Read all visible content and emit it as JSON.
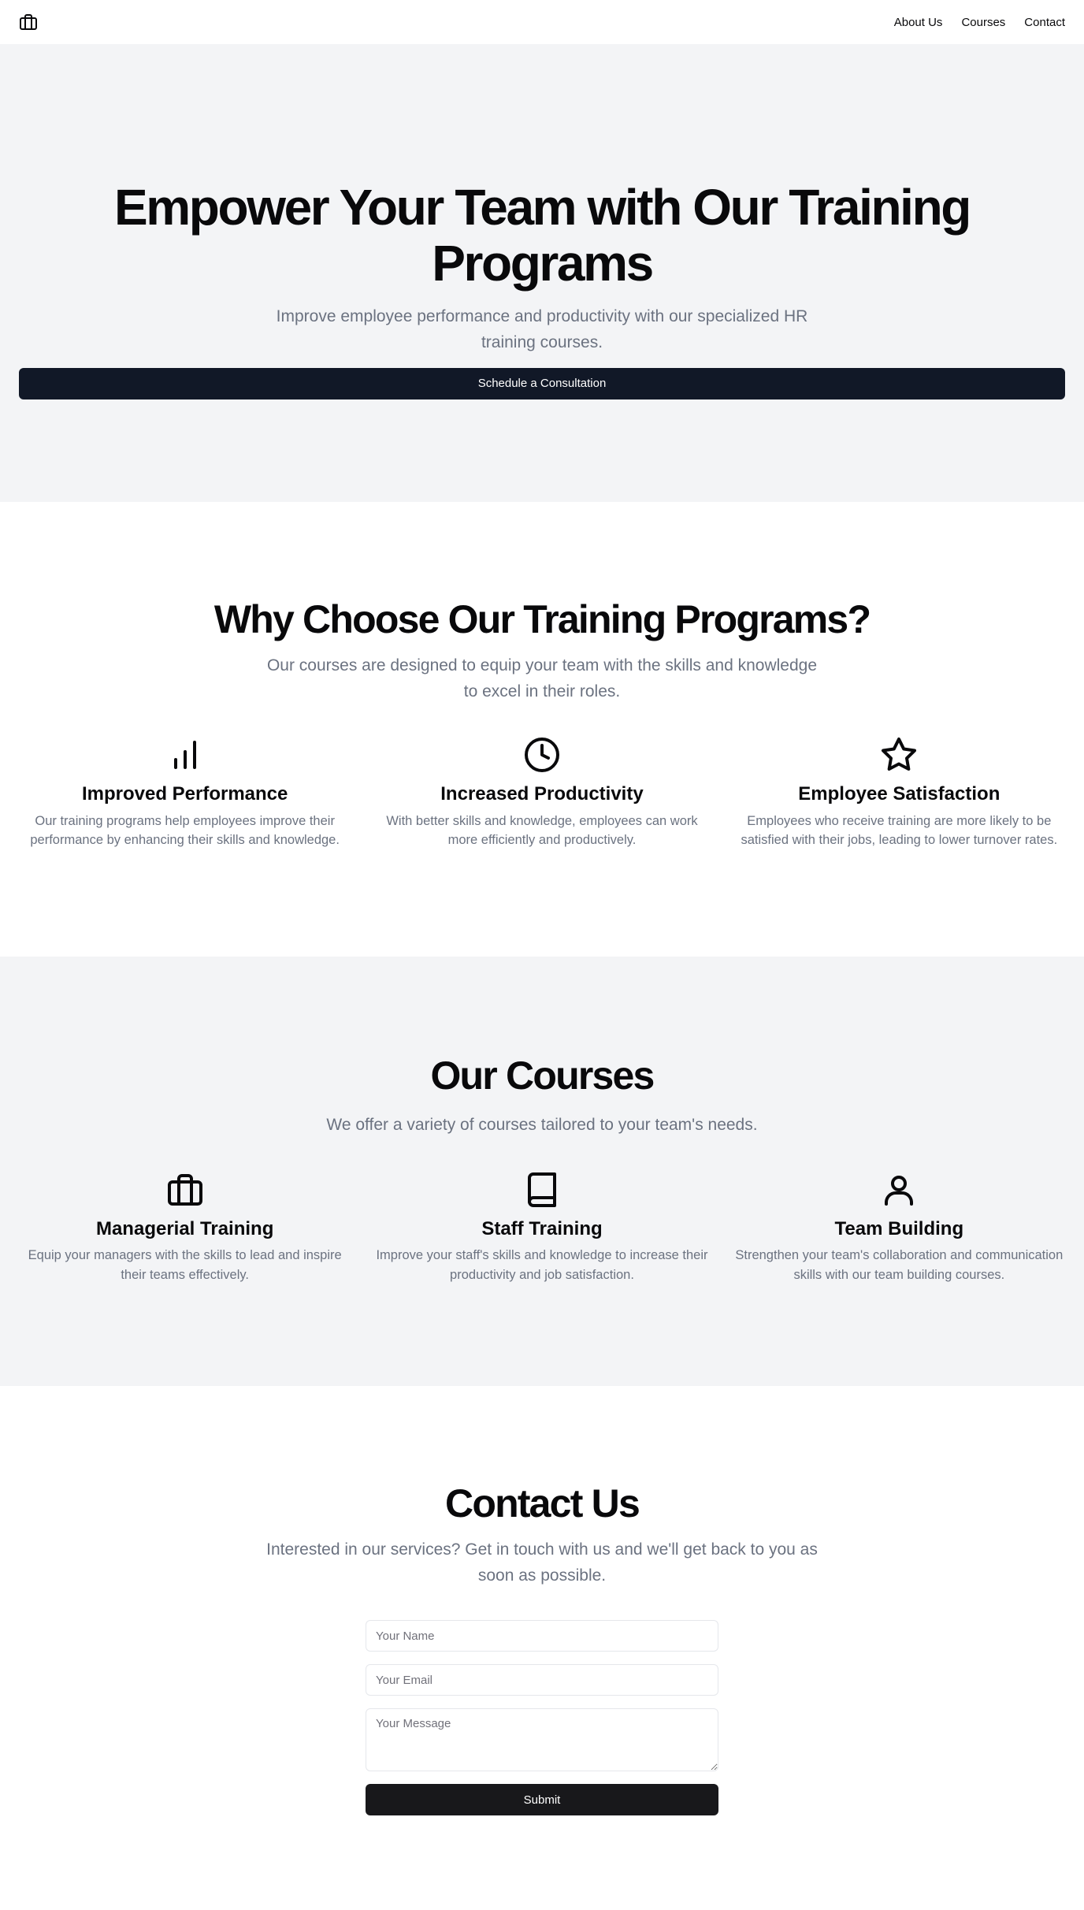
{
  "nav": {
    "logo_icon": "briefcase-icon",
    "links": [
      "About Us",
      "Courses",
      "Contact"
    ]
  },
  "hero": {
    "title": "Empower Your Team with Our Training Programs",
    "subtitle": "Improve employee performance and productivity with our specialized HR training courses.",
    "cta": "Schedule a Consultation"
  },
  "features": {
    "title": "Why Choose Our Training Programs?",
    "subtitle": "Our courses are designed to equip your team with the skills and knowledge to excel in their roles.",
    "items": [
      {
        "icon": "bar-chart-icon",
        "title": "Improved Performance",
        "text": "Our training programs help employees improve their performance by enhancing their skills and knowledge."
      },
      {
        "icon": "clock-icon",
        "title": "Increased Productivity",
        "text": "With better skills and knowledge, employees can work more efficiently and productively."
      },
      {
        "icon": "star-icon",
        "title": "Employee Satisfaction",
        "text": "Employees who receive training are more likely to be satisfied with their jobs, leading to lower turnover rates."
      }
    ]
  },
  "courses": {
    "title": "Our Courses",
    "subtitle": "We offer a variety of courses tailored to your team's needs.",
    "items": [
      {
        "icon": "briefcase-icon",
        "title": "Managerial Training",
        "text": "Equip your managers with the skills to lead and inspire their teams effectively."
      },
      {
        "icon": "book-icon",
        "title": "Staff Training",
        "text": "Improve your staff's skills and knowledge to increase their productivity and job satisfaction."
      },
      {
        "icon": "user-icon",
        "title": "Team Building",
        "text": "Strengthen your team's collaboration and communication skills with our team building courses."
      }
    ]
  },
  "contact": {
    "title": "Contact Us",
    "subtitle": "Interested in our services? Get in touch with us and we'll get back to you as soon as possible.",
    "name_placeholder": "Your Name",
    "email_placeholder": "Your Email",
    "message_placeholder": "Your Message",
    "submit": "Submit"
  }
}
